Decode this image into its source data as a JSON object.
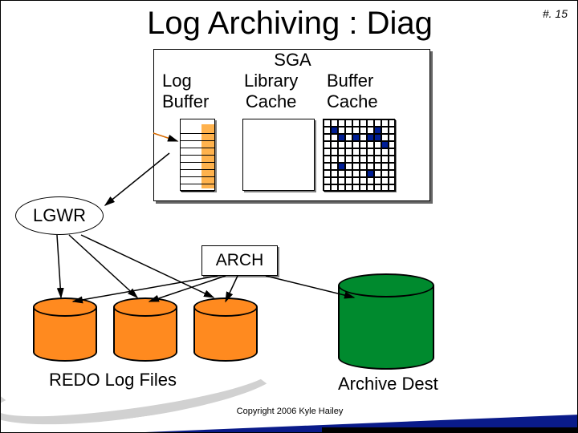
{
  "meta": {
    "page_number": "#. 15"
  },
  "title": "Log Archiving : Diag",
  "sga": {
    "title": "SGA",
    "log_buffer_label": "Log\nBuffer",
    "library_cache_label": "Library\nCache",
    "buffer_cache_label": "Buffer\nCache"
  },
  "processes": {
    "lgwr": "LGWR",
    "arch": "ARCH"
  },
  "storage": {
    "redo_label": "REDO Log Files",
    "archive_label": "Archive Dest"
  },
  "footer": {
    "copyright": "Copyright 2006 Kyle Hailey"
  },
  "colors": {
    "redo_cylinder": "#ff8a1f",
    "archive_cylinder": "#008a2e",
    "buffer_block": "#001e96",
    "wedge": "#0a1b8a"
  },
  "chart_data": {
    "type": "diagram",
    "nodes": [
      {
        "id": "sga",
        "label": "SGA",
        "children": [
          "log_buffer",
          "library_cache",
          "buffer_cache"
        ]
      },
      {
        "id": "log_buffer",
        "label": "Log Buffer"
      },
      {
        "id": "library_cache",
        "label": "Library Cache"
      },
      {
        "id": "buffer_cache",
        "label": "Buffer Cache"
      },
      {
        "id": "lgwr",
        "label": "LGWR"
      },
      {
        "id": "arch",
        "label": "ARCH"
      },
      {
        "id": "redo1",
        "label": "REDO Log File 1"
      },
      {
        "id": "redo2",
        "label": "REDO Log File 2"
      },
      {
        "id": "redo3",
        "label": "REDO Log File 3"
      },
      {
        "id": "archive_dest",
        "label": "Archive Dest"
      }
    ],
    "edges": [
      {
        "from": "log_buffer",
        "to": "lgwr"
      },
      {
        "from": "lgwr",
        "to": "redo1"
      },
      {
        "from": "lgwr",
        "to": "redo2"
      },
      {
        "from": "lgwr",
        "to": "redo3"
      },
      {
        "from": "arch",
        "to": "redo1"
      },
      {
        "from": "arch",
        "to": "redo2"
      },
      {
        "from": "arch",
        "to": "redo3"
      },
      {
        "from": "arch",
        "to": "archive_dest"
      }
    ]
  }
}
